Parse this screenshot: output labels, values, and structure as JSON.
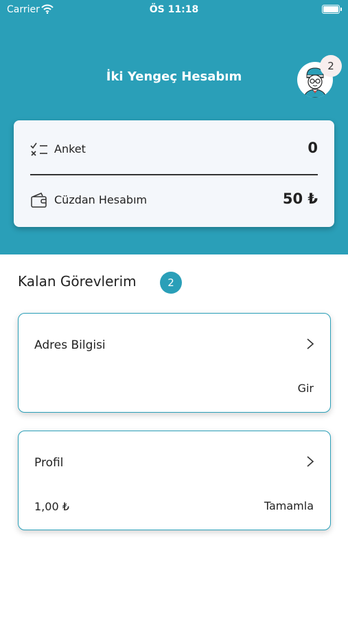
{
  "status_bar": {
    "carrier": "Carrier",
    "time": "ÖS 11:18"
  },
  "header": {
    "title": "İki Yengeç Hesabım",
    "notification_count": "2",
    "color": "#2a9fb8"
  },
  "summary": {
    "rows": [
      {
        "icon": "checklist-icon",
        "label": "Anket",
        "value": "0"
      },
      {
        "icon": "wallet-icon",
        "label": "Cüzdan Hesabım",
        "value": "50 ₺"
      }
    ]
  },
  "tasks_section": {
    "title": "Kalan Görevlerim",
    "count": "2",
    "items": [
      {
        "title": "Adres Bilgisi",
        "amount": "",
        "action": "Gir"
      },
      {
        "title": "Profil",
        "amount": "1,00 ₺",
        "action": "Tamamla"
      }
    ]
  }
}
